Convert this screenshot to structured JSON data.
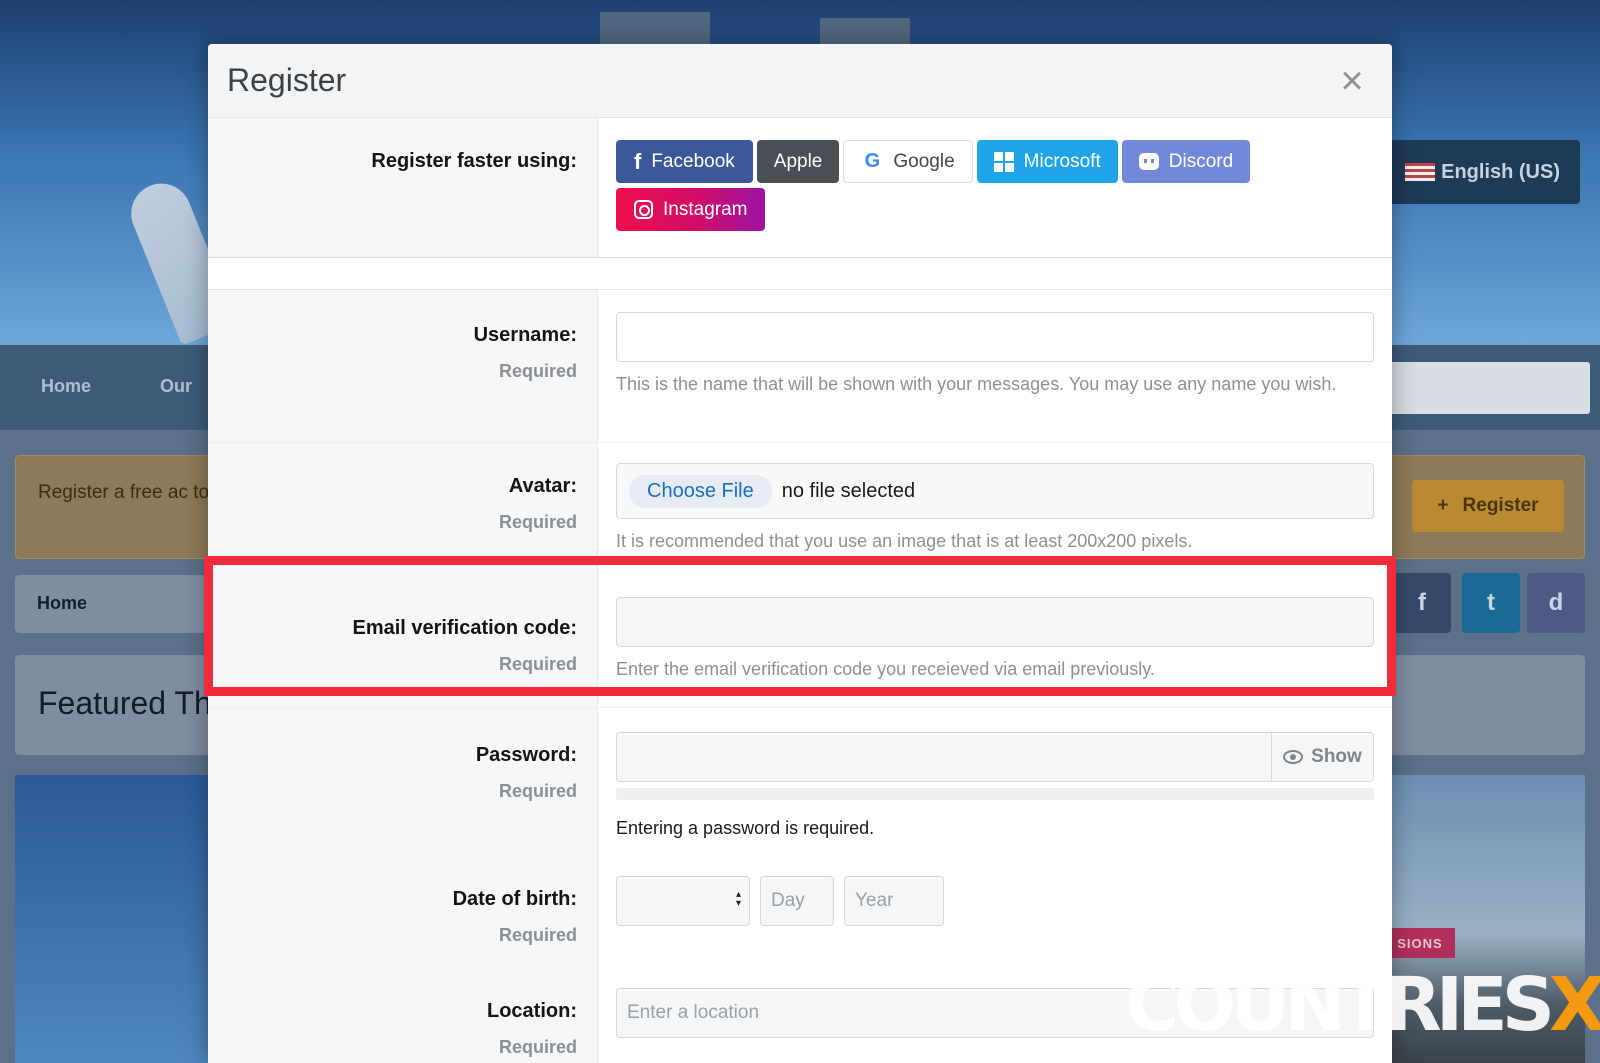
{
  "background": {
    "nav_items": [
      "Home",
      "Our"
    ],
    "language": "English (US)",
    "notice_text": "Register a free ac topics and posts, .",
    "register_button": "Register",
    "breadcrumb": "Home",
    "featured_title": "Featured Th",
    "tag": "SIONS",
    "social_icons": [
      "f",
      "t",
      "d"
    ]
  },
  "modal": {
    "title": "Register",
    "close_symbol": "×",
    "social": {
      "label": "Register faster using:",
      "buttons": [
        {
          "label": "Facebook",
          "icon": "facebook-icon"
        },
        {
          "label": "Apple",
          "icon": "apple"
        },
        {
          "label": "Google",
          "icon": "google-icon"
        },
        {
          "label": "Microsoft",
          "icon": "microsoft-icon"
        },
        {
          "label": "Discord",
          "icon": "discord-icon"
        },
        {
          "label": "Instagram",
          "icon": "instagram-icon"
        }
      ]
    },
    "required_text": "Required",
    "username": {
      "label": "Username:",
      "value": "",
      "hint": "This is the name that will be shown with your messages. You may use any name you wish."
    },
    "avatar": {
      "label": "Avatar:",
      "choose_label": "Choose File",
      "status": "no file selected",
      "hint": "It is recommended that you use an image that is at least 200x200 pixels."
    },
    "email_code": {
      "label": "Email verification code:",
      "value": "",
      "hint": "Enter the email verification code you receieved via email previously."
    },
    "password": {
      "label": "Password:",
      "show_label": "Show",
      "message": "Entering a password is required."
    },
    "dob": {
      "label": "Date of birth:",
      "month_value": "",
      "day_placeholder": "Day",
      "year_placeholder": "Year"
    },
    "location": {
      "label": "Location:",
      "placeholder": "Enter a location"
    }
  },
  "watermark": {
    "part1": "COUNTRIES",
    "part2": "XL"
  },
  "colors": {
    "facebook": "#3b5998",
    "apple": "#4a4f55",
    "microsoft": "#1fa4ea",
    "discord": "#7289da",
    "instagram": "#d00d67",
    "highlight": "#ef2b3c"
  }
}
